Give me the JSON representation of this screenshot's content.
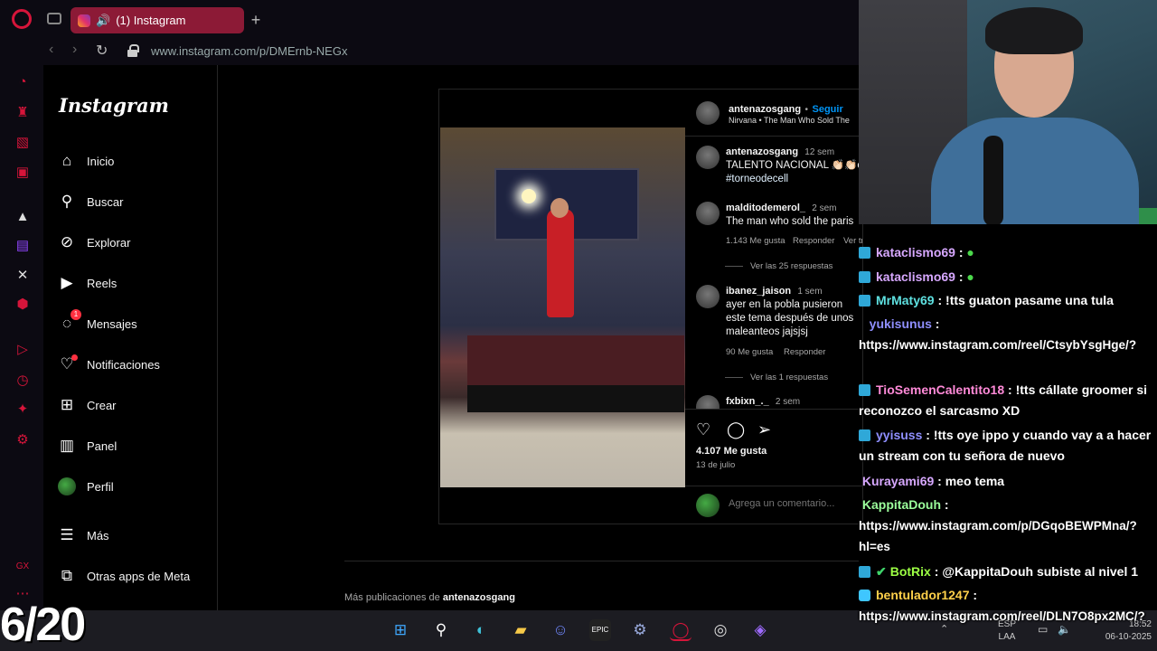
{
  "browser": {
    "tab_title": "(1) Instagram",
    "new_tab": "+",
    "url": "www.instagram.com/p/DMErnb-NEGx"
  },
  "instagram": {
    "logo": "Instagram",
    "nav": [
      {
        "label": "Inicio",
        "icon": "home-icon"
      },
      {
        "label": "Buscar",
        "icon": "search-icon"
      },
      {
        "label": "Explorar",
        "icon": "compass-icon"
      },
      {
        "label": "Reels",
        "icon": "reels-icon"
      },
      {
        "label": "Mensajes",
        "icon": "messenger-icon",
        "badge": "1"
      },
      {
        "label": "Notificaciones",
        "icon": "heart-icon"
      },
      {
        "label": "Crear",
        "icon": "plus-square-icon"
      },
      {
        "label": "Panel",
        "icon": "chart-icon"
      },
      {
        "label": "Perfil",
        "icon": "avatar"
      },
      {
        "label": "Más",
        "icon": "menu-icon"
      },
      {
        "label": "Otras apps de Meta",
        "icon": "meta-apps-icon"
      }
    ]
  },
  "post": {
    "author": "antenazosgang",
    "follow": "Seguir",
    "song": "Nirvana • The Man Who Sold The",
    "caption_user": "antenazosgang",
    "caption_time": "12 sem",
    "caption_text": "TALENTO NACIONAL 👏🏻👏🏻cu",
    "caption_hashtag": "#torneodecell",
    "comments": [
      {
        "user": "malditodemerol_",
        "time": "2 sem",
        "text": "The man who sold the paris",
        "likes": "1.143 Me gusta",
        "reply": "Responder",
        "translate": "Ver traducción",
        "replies": "Ver las 25 respuestas"
      },
      {
        "user": "ibanez_jaison",
        "time": "1 sem",
        "text": "ayer en la pobla pusieron este tema después de unos maleanteos jajsjsj",
        "likes": "90 Me gusta",
        "reply": "Responder",
        "replies": "Ver las 1 respuestas"
      },
      {
        "user": "fxbixn_._",
        "time": "2 sem"
      }
    ],
    "likes": "4.107 Me gusta",
    "date": "13 de julio",
    "comment_placeholder": "Agrega un comentario...",
    "more_posts_prefix": "Más publicaciones de ",
    "more_posts_user": "antenazosgang"
  },
  "chat": [
    {
      "user": "kataclismo69",
      "color": "#d7a8ff",
      "msg": "",
      "badge": "sub"
    },
    {
      "user": "kataclismo69",
      "color": "#d7a8ff",
      "msg": "",
      "badge": "sub"
    },
    {
      "user": "MrMaty69",
      "color": "#5ee0e0",
      "msg": "!tts guaton pasame una tula",
      "badge": "sub"
    },
    {
      "user": "yukisunus",
      "color": "#8f8fff",
      "msg": "https://www.instagram.com/reel/CtsybYsgHge/?",
      "badge": ""
    },
    {
      "user": "TioSemenCalentito18",
      "color": "#ff8ad8",
      "msg": "!tts cállate groomer si reconozco el sarcasmo XD",
      "badge": "sub"
    },
    {
      "user": "yyisuss",
      "color": "#8f8fff",
      "msg": "!tts oye ippo y cuando vay a a hacer un stream con tu señora de nuevo",
      "badge": "sub"
    },
    {
      "user": "Kurayami69",
      "color": "#d7a8ff",
      "msg": "meo tema",
      "badge": ""
    },
    {
      "user": "KappitaDouh",
      "color": "#9cff9c",
      "msg": "https://www.instagram.com/p/DGqoBEWPMna/?hl=es",
      "badge": ""
    },
    {
      "user": "BotRix",
      "color": "#9cff44",
      "msg": "@KappitaDouh subiste al nivel 1",
      "badge": "sub"
    },
    {
      "user": "bentulador1247",
      "color": "#ffd04a",
      "msg": "https://www.instagram.com/reel/DLN7O8px2MC/?",
      "badge": "gem"
    }
  ],
  "overlay_counter": "6/20",
  "taskbar": {
    "lang_top": "ESP",
    "lang_bottom": "LAA",
    "time": "18:52",
    "date": "06-10-2025"
  },
  "colors": {
    "accent": "#d6153a",
    "ig_blue": "#0095f6"
  }
}
